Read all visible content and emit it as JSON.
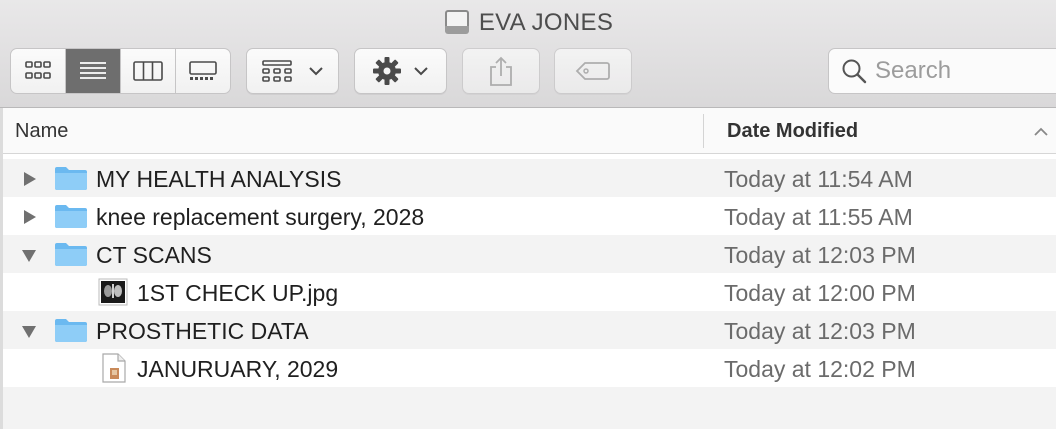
{
  "window": {
    "title": "EVA JONES",
    "title_icon": "external-drive-icon"
  },
  "toolbar": {
    "view_modes": [
      {
        "name": "icon-view",
        "icon": "icon-grid-icon",
        "active": false
      },
      {
        "name": "list-view",
        "icon": "list-icon",
        "active": true
      },
      {
        "name": "column-view",
        "icon": "columns-icon",
        "active": false
      },
      {
        "name": "gallery-view",
        "icon": "gallery-icon",
        "active": false
      }
    ],
    "group_icon": "group-by-icon",
    "action_icon": "gear-icon",
    "share_icon": "share-icon",
    "tag_icon": "tag-icon",
    "search": {
      "placeholder": "Search",
      "value": ""
    }
  },
  "list": {
    "columns": {
      "name": "Name",
      "date_modified": "Date Modified"
    },
    "sort_direction": "ascending",
    "rows": [
      {
        "name": "MY HEALTH ANALYSIS",
        "date": "Today at 11:54 AM",
        "kind": "folder",
        "expanded": false,
        "level": 0
      },
      {
        "name": "knee replacement surgery, 2028",
        "date": "Today at 11:55 AM",
        "kind": "folder",
        "expanded": false,
        "level": 0
      },
      {
        "name": "CT SCANS",
        "date": "Today at 12:03 PM",
        "kind": "folder",
        "expanded": true,
        "level": 0
      },
      {
        "name": "1ST CHECK UP.jpg",
        "date": "Today at 12:00 PM",
        "kind": "image",
        "level": 1
      },
      {
        "name": "PROSTHETIC DATA",
        "date": "Today at 12:03 PM",
        "kind": "folder",
        "expanded": true,
        "level": 0
      },
      {
        "name": "JANURUARY, 2029",
        "date": "Today at 12:02 PM",
        "kind": "document",
        "level": 1
      }
    ]
  },
  "colors": {
    "folder": "#6bb9f0",
    "toolbar_bg": "#e3e2e3",
    "active_segment": "#6e6e6e",
    "row_alt": "#f3f3f3"
  }
}
